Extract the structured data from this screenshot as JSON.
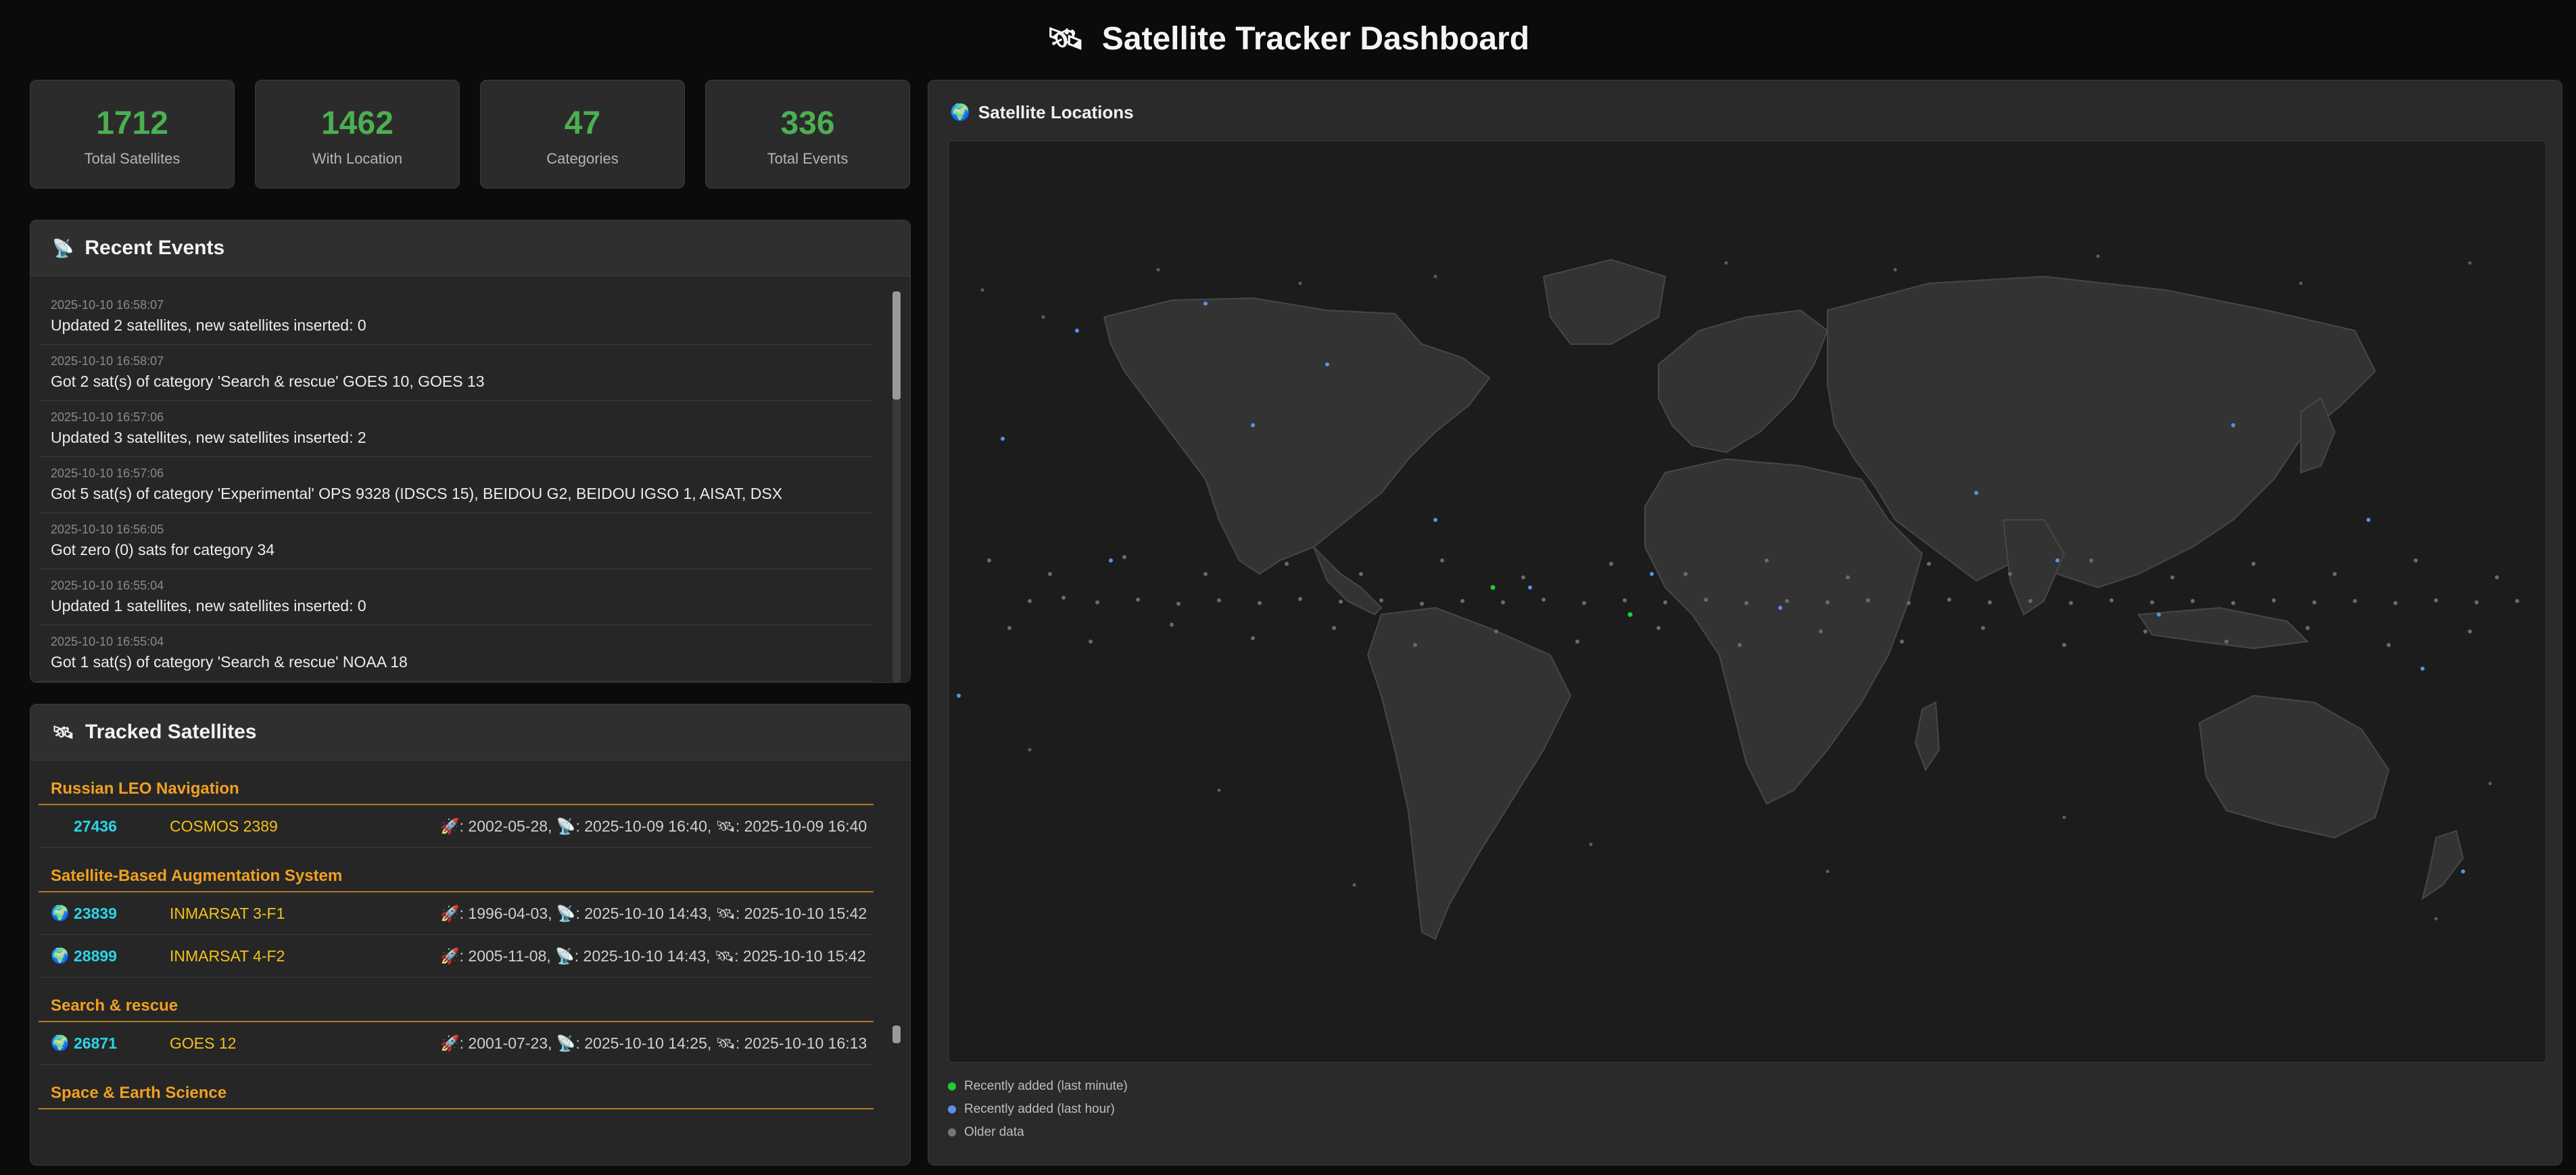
{
  "header": {
    "title": "Satellite Tracker Dashboard",
    "icon": "satellite-icon"
  },
  "stats": [
    {
      "value": "1712",
      "label": "Total Satellites"
    },
    {
      "value": "1462",
      "label": "With Location"
    },
    {
      "value": "47",
      "label": "Categories"
    },
    {
      "value": "336",
      "label": "Total Events"
    }
  ],
  "events_panel": {
    "title": "Recent Events",
    "icon": "satellite-dish-icon",
    "items": [
      {
        "time": "2025-10-10 16:58:07",
        "message": "Updated 2 satellites, new satellites inserted: 0"
      },
      {
        "time": "2025-10-10 16:58:07",
        "message": "Got 2 sat(s) of category 'Search & rescue' GOES 10, GOES 13"
      },
      {
        "time": "2025-10-10 16:57:06",
        "message": "Updated 3 satellites, new satellites inserted: 2"
      },
      {
        "time": "2025-10-10 16:57:06",
        "message": "Got 5 sat(s) of category 'Experimental' OPS 9328 (IDSCS 15), BEIDOU G2, BEIDOU IGSO 1, AISAT, DSX"
      },
      {
        "time": "2025-10-10 16:56:05",
        "message": "Got zero (0) sats for category 34"
      },
      {
        "time": "2025-10-10 16:55:04",
        "message": "Updated 1 satellites, new satellites inserted: 0"
      },
      {
        "time": "2025-10-10 16:55:04",
        "message": "Got 1 sat(s) of category 'Search & rescue' NOAA 18"
      }
    ]
  },
  "tracked_panel": {
    "title": "Tracked Satellites",
    "icon": "satellite-icon",
    "groups": [
      {
        "category": "Russian LEO Navigation",
        "sats": [
          {
            "has_location": false,
            "norad": "27436",
            "name": "COSMOS 2389",
            "dates": "🚀: 2002-05-28, 📡: 2025-10-09 16:40, 🛰: 2025-10-09 16:40"
          }
        ]
      },
      {
        "category": "Satellite-Based Augmentation System",
        "sats": [
          {
            "has_location": true,
            "norad": "23839",
            "name": "INMARSAT 3-F1",
            "dates": "🚀: 1996-04-03, 📡: 2025-10-10 14:43, 🛰: 2025-10-10 15:42"
          },
          {
            "has_location": true,
            "norad": "28899",
            "name": "INMARSAT 4-F2",
            "dates": "🚀: 2005-11-08, 📡: 2025-10-10 14:43, 🛰: 2025-10-10 15:42"
          }
        ]
      },
      {
        "category": "Search & rescue",
        "sats": [
          {
            "has_location": true,
            "norad": "26871",
            "name": "GOES 12",
            "dates": "🚀: 2001-07-23, 📡: 2025-10-10 14:25, 🛰: 2025-10-10 16:13"
          }
        ]
      },
      {
        "category": "Space & Earth Science",
        "sats": []
      }
    ]
  },
  "map_panel": {
    "title": "Satellite Locations",
    "icon": "globe-icon",
    "legend": [
      {
        "label": "Recently added (last minute)",
        "color": "#22cc33"
      },
      {
        "label": "Recently added (last hour)",
        "color": "#5b8ff0"
      },
      {
        "label": "Older data",
        "color": "#777777"
      }
    ]
  },
  "colors": {
    "accent_green": "#4caf50",
    "norad_cyan": "#29d6e8",
    "name_yellow": "#f2c21b",
    "category_orange": "#f0a020"
  }
}
